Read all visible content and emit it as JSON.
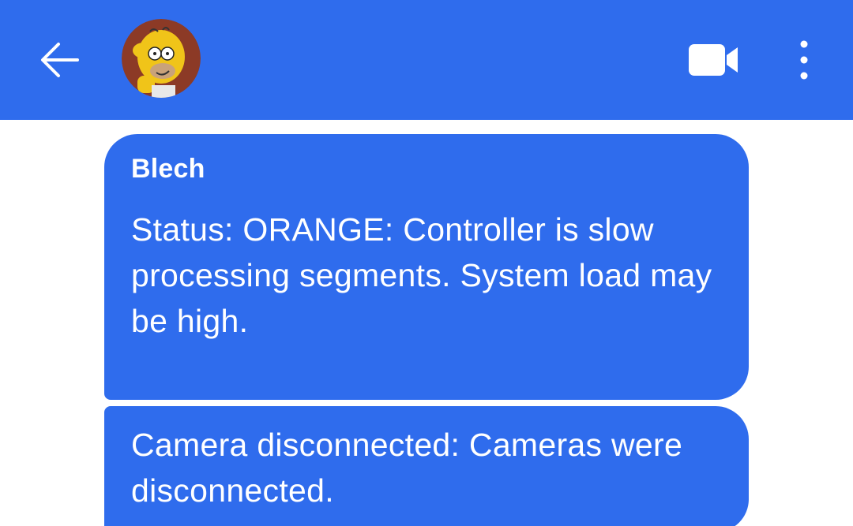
{
  "header": {
    "back_icon": "arrow-left-icon",
    "avatar_icon": "contact-avatar",
    "video_icon": "video-camera-icon",
    "more_icon": "more-vertical-icon",
    "background_color": "#2f6ced"
  },
  "messages": [
    {
      "sender": "Blech",
      "text": "Status: ORANGE: Controller is slow processing segments. System load may be high."
    },
    {
      "text": "Camera disconnected: Cameras were disconnected."
    }
  ],
  "colors": {
    "bubble": "#2f6ced",
    "text": "#ffffff",
    "background": "#ffffff"
  }
}
